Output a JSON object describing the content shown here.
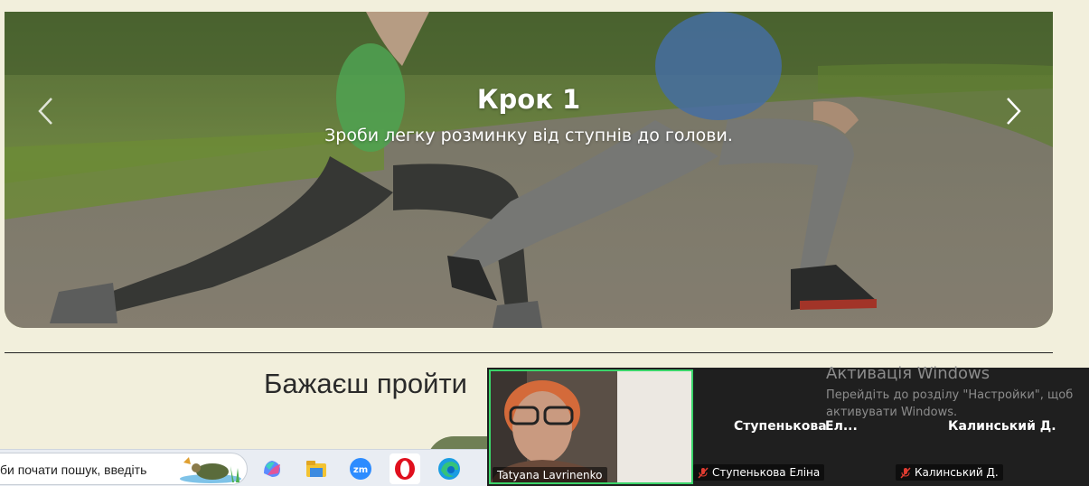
{
  "carousel": {
    "title": "Крок 1",
    "text": "Зроби легку розминку від ступнів до голови."
  },
  "section": {
    "question": "Бажаєш пройти"
  },
  "taskbar": {
    "search_text": "би почати пошук, введіть",
    "icons": [
      "copilot-icon",
      "file-explorer-icon",
      "zoom-icon",
      "opera-icon",
      "edge-icon"
    ]
  },
  "zoom": {
    "self_name": "Tatyana Lavrinenko",
    "participant1_big": "Ступенькова",
    "participant1_ellipsis": "Ел...",
    "participant2_big": "Калинський Д.",
    "participant1_label": "Ступенькова Еліна",
    "participant2_label": "Калинський Д."
  },
  "activation": {
    "title": "Активація Windows",
    "text": "Перейдіть до розділу \"Настройки\", щоб активувати Windows."
  },
  "colors": {
    "page_bg": "#f2efdc",
    "zoom_active_border": "#3bd46a",
    "muted_mic": "#e03c31"
  }
}
